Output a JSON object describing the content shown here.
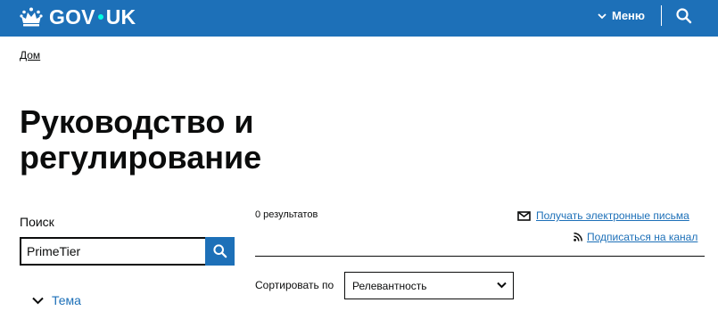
{
  "header": {
    "logo_text_left": "GOV",
    "logo_text_right": "UK",
    "menu_label": "Меню",
    "accent": "#1d70b8",
    "dot_color": "#00ffe0",
    "crown_icon": "crown-icon",
    "search_icon": "search-icon"
  },
  "breadcrumb": {
    "home": "Дом"
  },
  "page": {
    "title": "Руководство и регулирование"
  },
  "search": {
    "label": "Поиск",
    "value": "PrimeTier",
    "submit_icon": "search-icon"
  },
  "filters": {
    "topic_label": "Тема"
  },
  "results": {
    "count": "0 результатов",
    "email_link": "Получать электронные письма",
    "feed_link": "Подписаться на канал"
  },
  "sort": {
    "label": "Сортировать по",
    "selected": "Релевантность"
  }
}
